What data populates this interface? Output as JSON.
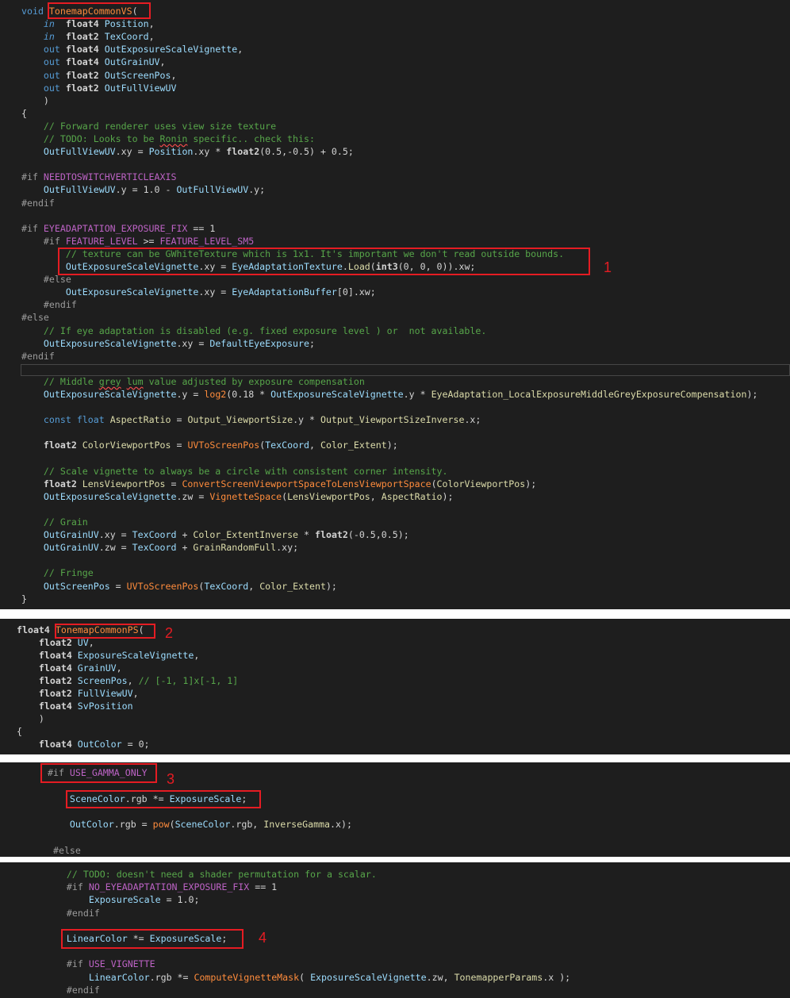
{
  "panels": [
    {
      "lines": [
        [
          {
            "t": "void",
            "c": "kw"
          },
          {
            "t": " "
          },
          {
            "t": "TonemapCommonVS",
            "c": "fnr"
          },
          {
            "t": "("
          }
        ],
        [
          {
            "t": "    "
          },
          {
            "t": "in",
            "c": "io"
          },
          {
            "t": "  "
          },
          {
            "t": "float4",
            "c": "ty"
          },
          {
            "t": " "
          },
          {
            "t": "Position",
            "c": "par"
          },
          {
            "t": ","
          }
        ],
        [
          {
            "t": "    "
          },
          {
            "t": "in",
            "c": "io"
          },
          {
            "t": "  "
          },
          {
            "t": "float2",
            "c": "ty"
          },
          {
            "t": " "
          },
          {
            "t": "TexCoord",
            "c": "par"
          },
          {
            "t": ","
          }
        ],
        [
          {
            "t": "    "
          },
          {
            "t": "out",
            "c": "kw"
          },
          {
            "t": " "
          },
          {
            "t": "float4",
            "c": "ty"
          },
          {
            "t": " "
          },
          {
            "t": "OutExposureScaleVignette",
            "c": "par"
          },
          {
            "t": ","
          }
        ],
        [
          {
            "t": "    "
          },
          {
            "t": "out",
            "c": "kw"
          },
          {
            "t": " "
          },
          {
            "t": "float4",
            "c": "ty"
          },
          {
            "t": " "
          },
          {
            "t": "OutGrainUV",
            "c": "par"
          },
          {
            "t": ","
          }
        ],
        [
          {
            "t": "    "
          },
          {
            "t": "out",
            "c": "kw"
          },
          {
            "t": " "
          },
          {
            "t": "float2",
            "c": "ty"
          },
          {
            "t": " "
          },
          {
            "t": "OutScreenPos",
            "c": "par"
          },
          {
            "t": ","
          }
        ],
        [
          {
            "t": "    "
          },
          {
            "t": "out",
            "c": "kw"
          },
          {
            "t": " "
          },
          {
            "t": "float2",
            "c": "ty"
          },
          {
            "t": " "
          },
          {
            "t": "OutFullViewUV",
            "c": "par"
          }
        ],
        [
          {
            "t": "    )"
          }
        ],
        [
          {
            "t": "{"
          }
        ],
        [
          {
            "t": "    "
          },
          {
            "t": "// Forward renderer uses view size texture",
            "c": "cm"
          }
        ],
        [
          {
            "t": "    "
          },
          {
            "t": "// TODO: Looks to be ",
            "c": "cm"
          },
          {
            "t": "Ronin",
            "c": "cm sq"
          },
          {
            "t": " specific.. check this:",
            "c": "cm"
          }
        ],
        [
          {
            "t": "    "
          },
          {
            "t": "OutFullViewUV",
            "c": "par"
          },
          {
            "t": ".xy = "
          },
          {
            "t": "Position",
            "c": "par"
          },
          {
            "t": ".xy * "
          },
          {
            "t": "float2",
            "c": "ty"
          },
          {
            "t": "(0.5,-0.5) + 0.5;"
          }
        ],
        [],
        [
          {
            "t": "#if ",
            "c": "pp"
          },
          {
            "t": "NEEDTOSWITCHVERTICLEAXIS",
            "c": "mac"
          }
        ],
        [
          {
            "t": "    "
          },
          {
            "t": "OutFullViewUV",
            "c": "par"
          },
          {
            "t": ".y = 1.0 - "
          },
          {
            "t": "OutFullViewUV",
            "c": "par"
          },
          {
            "t": ".y;"
          }
        ],
        [
          {
            "t": "#endif",
            "c": "pp"
          }
        ],
        [],
        [
          {
            "t": "#if ",
            "c": "pp"
          },
          {
            "t": "EYEADAPTATION_EXPOSURE_FIX",
            "c": "mac"
          },
          {
            "t": " == 1"
          }
        ],
        [
          {
            "t": "    "
          },
          {
            "t": "#if ",
            "c": "pp"
          },
          {
            "t": "FEATURE_LEVEL",
            "c": "mac"
          },
          {
            "t": " >= "
          },
          {
            "t": "FEATURE_LEVEL_SM5",
            "c": "mac"
          }
        ],
        [
          {
            "t": "        "
          },
          {
            "t": "// texture can be GWhiteTexture which is 1x1. It's important we don't read outside bounds.",
            "c": "cm"
          }
        ],
        [
          {
            "t": "        "
          },
          {
            "t": "OutExposureScaleVignette",
            "c": "par"
          },
          {
            "t": ".xy = "
          },
          {
            "t": "EyeAdaptationTexture",
            "c": "par"
          },
          {
            "t": "."
          },
          {
            "t": "Load",
            "c": "fn"
          },
          {
            "t": "("
          },
          {
            "t": "int3",
            "c": "ty"
          },
          {
            "t": "(0, 0, 0)).xw;"
          }
        ],
        [
          {
            "t": "    "
          },
          {
            "t": "#else",
            "c": "pp"
          }
        ],
        [
          {
            "t": "        "
          },
          {
            "t": "OutExposureScaleVignette",
            "c": "par"
          },
          {
            "t": ".xy = "
          },
          {
            "t": "EyeAdaptationBuffer",
            "c": "par"
          },
          {
            "t": "[0].xw;"
          }
        ],
        [
          {
            "t": "    "
          },
          {
            "t": "#endif",
            "c": "pp"
          }
        ],
        [
          {
            "t": "#else",
            "c": "pp"
          }
        ],
        [
          {
            "t": "    "
          },
          {
            "t": "// If eye adaptation is disabled (e.g. fixed exposure level ) or  not available.",
            "c": "cm"
          }
        ],
        [
          {
            "t": "    "
          },
          {
            "t": "OutExposureScaleVignette",
            "c": "par"
          },
          {
            "t": ".xy = "
          },
          {
            "t": "DefaultEyeExposure",
            "c": "par"
          },
          {
            "t": ";"
          }
        ],
        [
          {
            "t": "#endif",
            "c": "pp"
          }
        ],
        [],
        [
          {
            "t": "    "
          },
          {
            "t": "// Middle ",
            "c": "cm"
          },
          {
            "t": "grey",
            "c": "cm sq"
          },
          {
            "t": " ",
            "c": "cm"
          },
          {
            "t": "lum",
            "c": "cm sq"
          },
          {
            "t": " value adjusted by exposure compensation",
            "c": "cm"
          }
        ],
        [
          {
            "t": "    "
          },
          {
            "t": "OutExposureScaleVignette",
            "c": "par"
          },
          {
            "t": ".y = "
          },
          {
            "t": "log2",
            "c": "fnr"
          },
          {
            "t": "(0.18 * "
          },
          {
            "t": "OutExposureScaleVignette",
            "c": "par"
          },
          {
            "t": ".y * "
          },
          {
            "t": "EyeAdaptation_LocalExposureMiddleGreyExposureCompensation",
            "c": "id"
          },
          {
            "t": ");"
          }
        ],
        [],
        [
          {
            "t": "    "
          },
          {
            "t": "const",
            "c": "kw"
          },
          {
            "t": " "
          },
          {
            "t": "float",
            "c": "kw"
          },
          {
            "t": " "
          },
          {
            "t": "AspectRatio",
            "c": "id"
          },
          {
            "t": " = "
          },
          {
            "t": "Output_ViewportSize",
            "c": "id"
          },
          {
            "t": ".y * "
          },
          {
            "t": "Output_ViewportSizeInverse",
            "c": "id"
          },
          {
            "t": ".x;"
          }
        ],
        [],
        [
          {
            "t": "    "
          },
          {
            "t": "float2",
            "c": "ty"
          },
          {
            "t": " "
          },
          {
            "t": "ColorViewportPos",
            "c": "id"
          },
          {
            "t": " = "
          },
          {
            "t": "UVToScreenPos",
            "c": "fnr"
          },
          {
            "t": "("
          },
          {
            "t": "TexCoord",
            "c": "par"
          },
          {
            "t": ", "
          },
          {
            "t": "Color_Extent",
            "c": "id"
          },
          {
            "t": ");"
          }
        ],
        [],
        [
          {
            "t": "    "
          },
          {
            "t": "// Scale vignette to always be a circle with consistent corner intensity.",
            "c": "cm"
          }
        ],
        [
          {
            "t": "    "
          },
          {
            "t": "float2",
            "c": "ty"
          },
          {
            "t": " "
          },
          {
            "t": "LensViewportPos",
            "c": "id"
          },
          {
            "t": " = "
          },
          {
            "t": "ConvertScreenViewportSpaceToLensViewportSpace",
            "c": "fnr"
          },
          {
            "t": "("
          },
          {
            "t": "ColorViewportPos",
            "c": "id"
          },
          {
            "t": ");"
          }
        ],
        [
          {
            "t": "    "
          },
          {
            "t": "OutExposureScaleVignette",
            "c": "par"
          },
          {
            "t": ".zw = "
          },
          {
            "t": "VignetteSpace",
            "c": "fnr"
          },
          {
            "t": "("
          },
          {
            "t": "LensViewportPos",
            "c": "id"
          },
          {
            "t": ", "
          },
          {
            "t": "AspectRatio",
            "c": "id"
          },
          {
            "t": ");"
          }
        ],
        [],
        [
          {
            "t": "    "
          },
          {
            "t": "// Grain",
            "c": "cm"
          }
        ],
        [
          {
            "t": "    "
          },
          {
            "t": "OutGrainUV",
            "c": "par"
          },
          {
            "t": ".xy = "
          },
          {
            "t": "TexCoord",
            "c": "par"
          },
          {
            "t": " + "
          },
          {
            "t": "Color_ExtentInverse",
            "c": "id"
          },
          {
            "t": " * "
          },
          {
            "t": "float2",
            "c": "ty"
          },
          {
            "t": "(-0.5,0.5);"
          }
        ],
        [
          {
            "t": "    "
          },
          {
            "t": "OutGrainUV",
            "c": "par"
          },
          {
            "t": ".zw = "
          },
          {
            "t": "TexCoord",
            "c": "par"
          },
          {
            "t": " + "
          },
          {
            "t": "GrainRandomFull",
            "c": "id"
          },
          {
            "t": ".xy;"
          }
        ],
        [],
        [
          {
            "t": "    "
          },
          {
            "t": "// Fringe",
            "c": "cm"
          }
        ],
        [
          {
            "t": "    "
          },
          {
            "t": "OutScreenPos",
            "c": "par"
          },
          {
            "t": " = "
          },
          {
            "t": "UVToScreenPos",
            "c": "fnr"
          },
          {
            "t": "("
          },
          {
            "t": "TexCoord",
            "c": "par"
          },
          {
            "t": ", "
          },
          {
            "t": "Color_Extent",
            "c": "id"
          },
          {
            "t": ");"
          }
        ],
        [
          {
            "t": "}"
          }
        ]
      ]
    },
    {
      "lines": [
        [
          {
            "t": "float4",
            "c": "ty"
          },
          {
            "t": " "
          },
          {
            "t": "TonemapCommonPS",
            "c": "fnr"
          },
          {
            "t": "("
          }
        ],
        [
          {
            "t": "    "
          },
          {
            "t": "float2",
            "c": "ty"
          },
          {
            "t": " "
          },
          {
            "t": "UV",
            "c": "par"
          },
          {
            "t": ","
          }
        ],
        [
          {
            "t": "    "
          },
          {
            "t": "float4",
            "c": "ty"
          },
          {
            "t": " "
          },
          {
            "t": "ExposureScaleVignette",
            "c": "par"
          },
          {
            "t": ","
          }
        ],
        [
          {
            "t": "    "
          },
          {
            "t": "float4",
            "c": "ty"
          },
          {
            "t": " "
          },
          {
            "t": "GrainUV",
            "c": "par"
          },
          {
            "t": ","
          }
        ],
        [
          {
            "t": "    "
          },
          {
            "t": "float2",
            "c": "ty"
          },
          {
            "t": " "
          },
          {
            "t": "ScreenPos",
            "c": "par"
          },
          {
            "t": ", "
          },
          {
            "t": "// [-1, 1]x[-1, 1]",
            "c": "cm"
          }
        ],
        [
          {
            "t": "    "
          },
          {
            "t": "float2",
            "c": "ty"
          },
          {
            "t": " "
          },
          {
            "t": "FullViewUV",
            "c": "par"
          },
          {
            "t": ","
          }
        ],
        [
          {
            "t": "    "
          },
          {
            "t": "float4",
            "c": "ty"
          },
          {
            "t": " "
          },
          {
            "t": "SvPosition",
            "c": "par"
          }
        ],
        [
          {
            "t": "    )"
          }
        ],
        [
          {
            "t": "{"
          }
        ],
        [
          {
            "t": "    "
          },
          {
            "t": "float4",
            "c": "ty"
          },
          {
            "t": " "
          },
          {
            "t": "OutColor",
            "c": "par"
          },
          {
            "t": " = 0;"
          }
        ]
      ]
    },
    {
      "lines": [
        [
          {
            "t": "#if ",
            "c": "pp"
          },
          {
            "t": "USE_GAMMA_ONLY",
            "c": "mac"
          }
        ],
        [],
        [
          {
            "t": "    "
          },
          {
            "t": "SceneColor",
            "c": "par"
          },
          {
            "t": ".rgb *= "
          },
          {
            "t": "ExposureScale",
            "c": "par"
          },
          {
            "t": ";"
          }
        ],
        [],
        [
          {
            "t": "    "
          },
          {
            "t": "OutColor",
            "c": "par"
          },
          {
            "t": ".rgb = "
          },
          {
            "t": "pow",
            "c": "fnr"
          },
          {
            "t": "("
          },
          {
            "t": "SceneColor",
            "c": "par"
          },
          {
            "t": ".rgb, "
          },
          {
            "t": "InverseGamma",
            "c": "id"
          },
          {
            "t": ".x);"
          }
        ],
        [],
        [
          {
            "t": " "
          },
          {
            "t": "#else",
            "c": "pp"
          }
        ]
      ]
    },
    {
      "lines": [
        [
          {
            "t": "    "
          },
          {
            "t": "// TODO: doesn't need a shader permutation for a scalar.",
            "c": "cm"
          }
        ],
        [
          {
            "t": "    "
          },
          {
            "t": "#if ",
            "c": "pp"
          },
          {
            "t": "NO_EYEADAPTATION_EXPOSURE_FIX",
            "c": "mac"
          },
          {
            "t": " == 1"
          }
        ],
        [
          {
            "t": "        "
          },
          {
            "t": "ExposureScale",
            "c": "par"
          },
          {
            "t": " = 1.0;"
          }
        ],
        [
          {
            "t": "    "
          },
          {
            "t": "#endif",
            "c": "pp"
          }
        ],
        [],
        [
          {
            "t": "    "
          },
          {
            "t": "LinearColor",
            "c": "par"
          },
          {
            "t": " *= "
          },
          {
            "t": "ExposureScale",
            "c": "par"
          },
          {
            "t": ";"
          }
        ],
        [],
        [
          {
            "t": "    "
          },
          {
            "t": "#if ",
            "c": "pp"
          },
          {
            "t": "USE_VIGNETTE",
            "c": "mac"
          }
        ],
        [
          {
            "t": "        "
          },
          {
            "t": "LinearColor",
            "c": "par"
          },
          {
            "t": ".rgb *= "
          },
          {
            "t": "ComputeVignetteMask",
            "c": "fnr"
          },
          {
            "t": "( "
          },
          {
            "t": "ExposureScaleVignette",
            "c": "par"
          },
          {
            "t": ".zw, "
          },
          {
            "t": "TonemapperParams",
            "c": "id"
          },
          {
            "t": ".x );"
          }
        ],
        [
          {
            "t": "    "
          },
          {
            "t": "#endif",
            "c": "pp"
          }
        ]
      ]
    }
  ],
  "annotations": [
    "1",
    "2",
    "3",
    "4"
  ]
}
